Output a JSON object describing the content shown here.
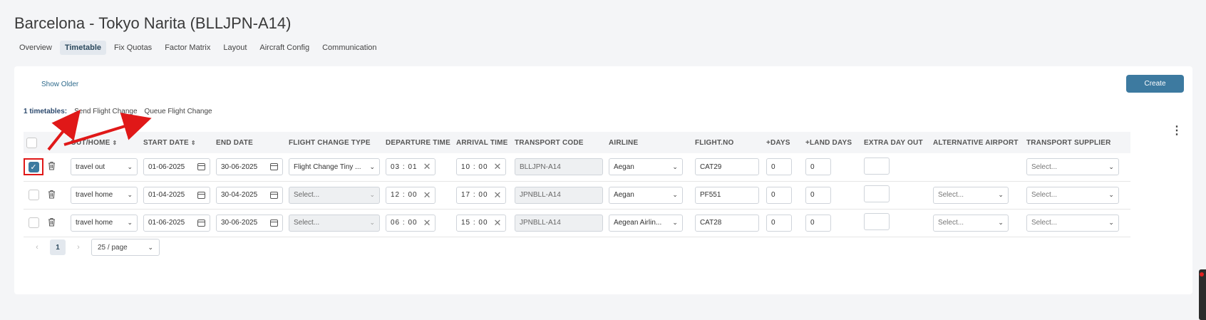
{
  "page": {
    "title": "Barcelona - Tokyo Narita (BLLJPN-A14)"
  },
  "tabs": [
    {
      "label": "Overview",
      "active": false
    },
    {
      "label": "Timetable",
      "active": true
    },
    {
      "label": "Fix Quotas",
      "active": false
    },
    {
      "label": "Factor Matrix",
      "active": false
    },
    {
      "label": "Layout",
      "active": false
    },
    {
      "label": "Aircraft Config",
      "active": false
    },
    {
      "label": "Communication",
      "active": false
    }
  ],
  "toolbar": {
    "show_older": "Show Older",
    "create": "Create",
    "timetable_count": "1 timetables:",
    "send_flight_change": "Send Flight Change",
    "queue_flight_change": "Queue Flight Change"
  },
  "table": {
    "headers": {
      "out_home": "OUT/HOME",
      "start_date": "START DATE",
      "end_date": "END DATE",
      "flight_change_type": "FLIGHT CHANGE TYPE",
      "departure_time": "DEPARTURE TIME",
      "arrival_time": "ARRIVAL TIME",
      "transport_code": "TRANSPORT CODE",
      "airline": "AIRLINE",
      "flight_no": "FLIGHT.NO",
      "plus_days": "+DAYS",
      "plus_land_days": "+LAND DAYS",
      "extra_day_out": "EXTRA DAY OUT",
      "alternative_airport": "ALTERNATIVE AIRPORT",
      "transport_supplier": "TRANSPORT SUPPLIER"
    },
    "rows": [
      {
        "checked": true,
        "direction": "travel out",
        "start_date": "01-06-2025",
        "end_date": "30-06-2025",
        "flight_change_type": "Flight Change Tiny ...",
        "departure_time": "03 : 01",
        "arrival_time": "10 : 00",
        "transport_code": "BLLJPN-A14",
        "airline": "Aegan",
        "flight_no": "CAT29",
        "plus_days": "0",
        "plus_land_days": "0",
        "extra_day_out": "",
        "alternative_airport": "",
        "transport_supplier": "Select..."
      },
      {
        "checked": false,
        "direction": "travel home",
        "start_date": "01-04-2025",
        "end_date": "30-04-2025",
        "flight_change_type": "Select...",
        "departure_time": "12 : 00",
        "arrival_time": "17 : 00",
        "transport_code": "JPNBLL-A14",
        "airline": "Aegan",
        "flight_no": "PF551",
        "plus_days": "0",
        "plus_land_days": "0",
        "extra_day_out": "",
        "alternative_airport": "Select...",
        "transport_supplier": "Select..."
      },
      {
        "checked": false,
        "direction": "travel home",
        "start_date": "01-06-2025",
        "end_date": "30-06-2025",
        "flight_change_type": "Select...",
        "departure_time": "06 : 00",
        "arrival_time": "15 : 00",
        "transport_code": "JPNBLL-A14",
        "airline": "Aegean Airlin...",
        "flight_no": "CAT28",
        "plus_days": "0",
        "plus_land_days": "0",
        "extra_day_out": "",
        "alternative_airport": "Select...",
        "transport_supplier": "Select..."
      }
    ]
  },
  "pagination": {
    "prev": "‹",
    "current": "1",
    "next": "›",
    "page_size": "25 / page"
  },
  "icons": {
    "trash": "trash-icon",
    "calendar": "calendar-icon",
    "clear": "close-icon",
    "chevron": "chevron-down-icon",
    "kebab": "more-vertical-icon"
  },
  "colors": {
    "accent": "#3d7aa0",
    "annotation": "#e01818"
  }
}
